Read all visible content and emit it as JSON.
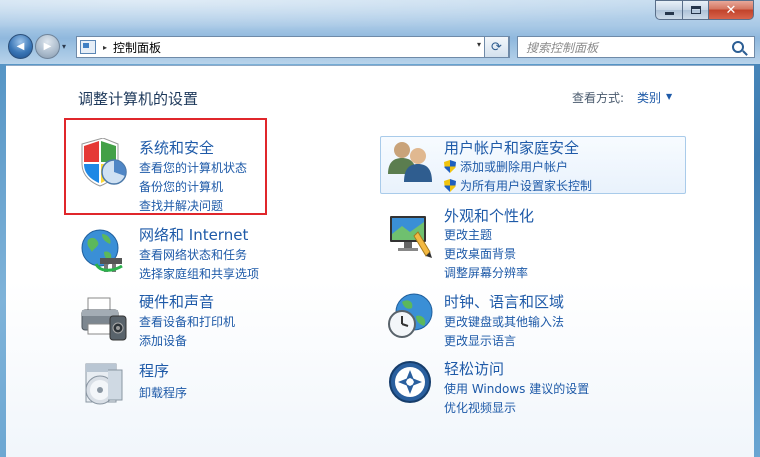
{
  "window": {
    "controls": {
      "minimize": "minimize",
      "maximize": "maximize",
      "close": "✕"
    }
  },
  "nav": {
    "back_glyph": "◀",
    "forward_glyph": "▶",
    "dropdown_glyph": "▾"
  },
  "address": {
    "separator": "▸",
    "path": "控制面板",
    "dropdown_glyph": "▾",
    "refresh_glyph": "⟳"
  },
  "search": {
    "placeholder": "搜索控制面板"
  },
  "page": {
    "title": "调整计算机的设置",
    "view_by_label": "查看方式:",
    "view_by_value": "类别",
    "view_by_arrow": "▼"
  },
  "categories": {
    "system": {
      "title": "系统和安全",
      "links": [
        "查看您的计算机状态",
        "备份您的计算机",
        "查找并解决问题"
      ]
    },
    "network": {
      "title": "网络和 Internet",
      "links": [
        "查看网络状态和任务",
        "选择家庭组和共享选项"
      ]
    },
    "hardware": {
      "title": "硬件和声音",
      "links": [
        "查看设备和打印机",
        "添加设备"
      ]
    },
    "programs": {
      "title": "程序",
      "links": [
        "卸载程序"
      ]
    },
    "users": {
      "title": "用户帐户和家庭安全",
      "links": [
        "添加或删除用户帐户",
        "为所有用户设置家长控制"
      ]
    },
    "appearance": {
      "title": "外观和个性化",
      "links": [
        "更改主题",
        "更改桌面背景",
        "调整屏幕分辨率"
      ]
    },
    "clock": {
      "title": "时钟、语言和区域",
      "links": [
        "更改键盘或其他输入法",
        "更改显示语言"
      ]
    },
    "ease": {
      "title": "轻松访问",
      "links": [
        "使用 Windows 建议的设置",
        "优化视频显示"
      ]
    }
  },
  "colors": {
    "link": "#1e5aa8",
    "title": "#1e395b",
    "highlight": "#e0262b"
  }
}
